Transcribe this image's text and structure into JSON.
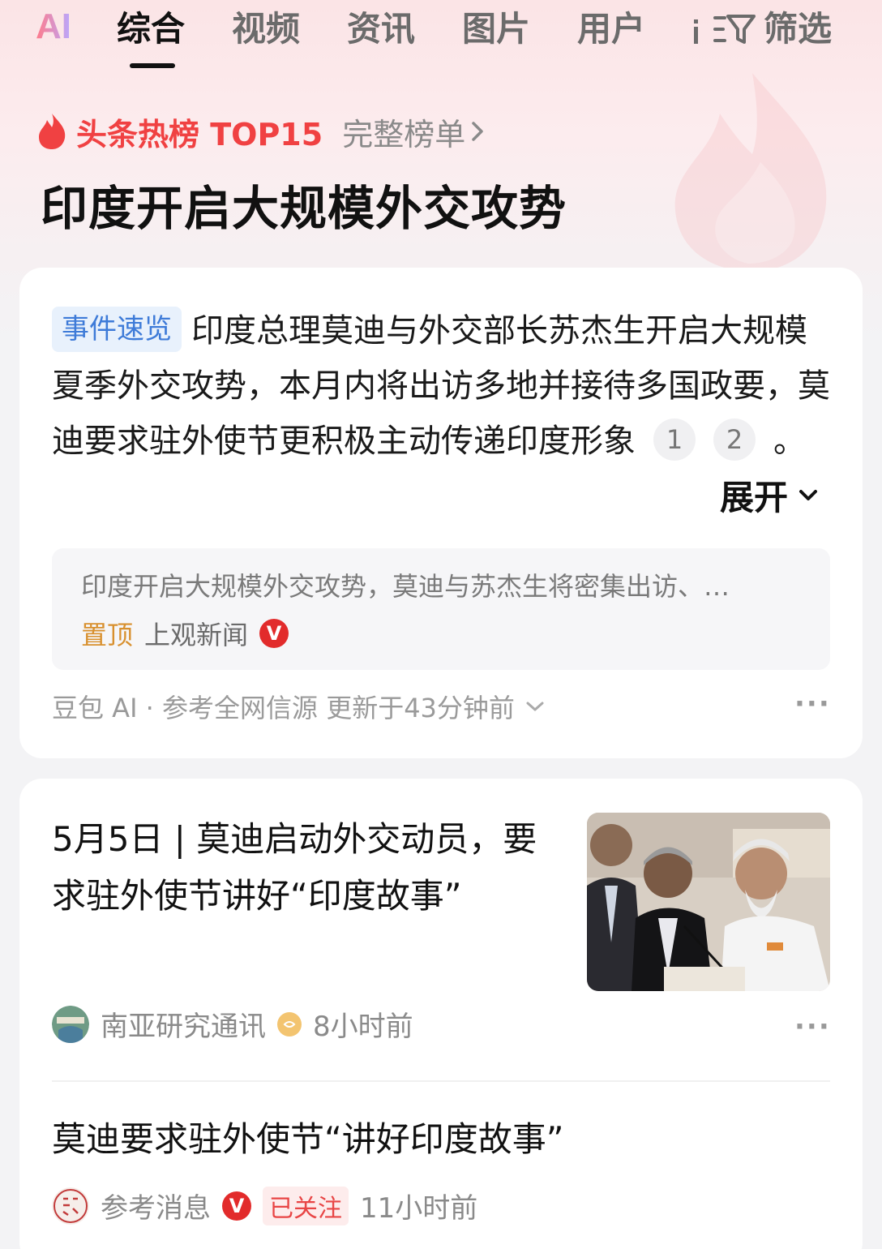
{
  "tabs": {
    "ai": "AI",
    "items": [
      "综合",
      "视频",
      "资讯",
      "图片",
      "用户"
    ],
    "filter": "筛选"
  },
  "hot": {
    "label": "头条热榜 TOP15",
    "full_list": "完整榜单"
  },
  "page_title": "印度开启大规模外交攻势",
  "summary": {
    "tag": "事件速览",
    "text": "印度总理莫迪与外交部长苏杰生开启大规模夏季外交攻势，本月内将出访多地并接待多国政要，莫迪要求驻外使节更积极主动传递印度形象",
    "refs": [
      "1",
      "2"
    ],
    "end_punct": "。",
    "expand": "展开",
    "pinned_snippet": "印度开启大规模外交攻势，莫迪与苏杰生将密集出访、…",
    "pinned_tag": "置顶",
    "pinned_source": "上观新闻",
    "verified": "V",
    "footer": "豆包 AI · 参考全网信源 更新于43分钟前",
    "more": "···"
  },
  "news": [
    {
      "title": "5月5日 | 莫迪启动外交动员，要求驻外使节讲好“印度故事”",
      "source": "南亚研究通讯",
      "time": "8小时前",
      "more": "···"
    },
    {
      "title": "莫迪要求驻外使节“讲好印度故事”",
      "source": "参考消息",
      "verified": "V",
      "followed": "已关注",
      "time": "11小时前"
    }
  ],
  "colors": {
    "accent_red": "#f04142",
    "tag_blue": "#3e7bd8",
    "pin_gold": "#d8902e"
  }
}
